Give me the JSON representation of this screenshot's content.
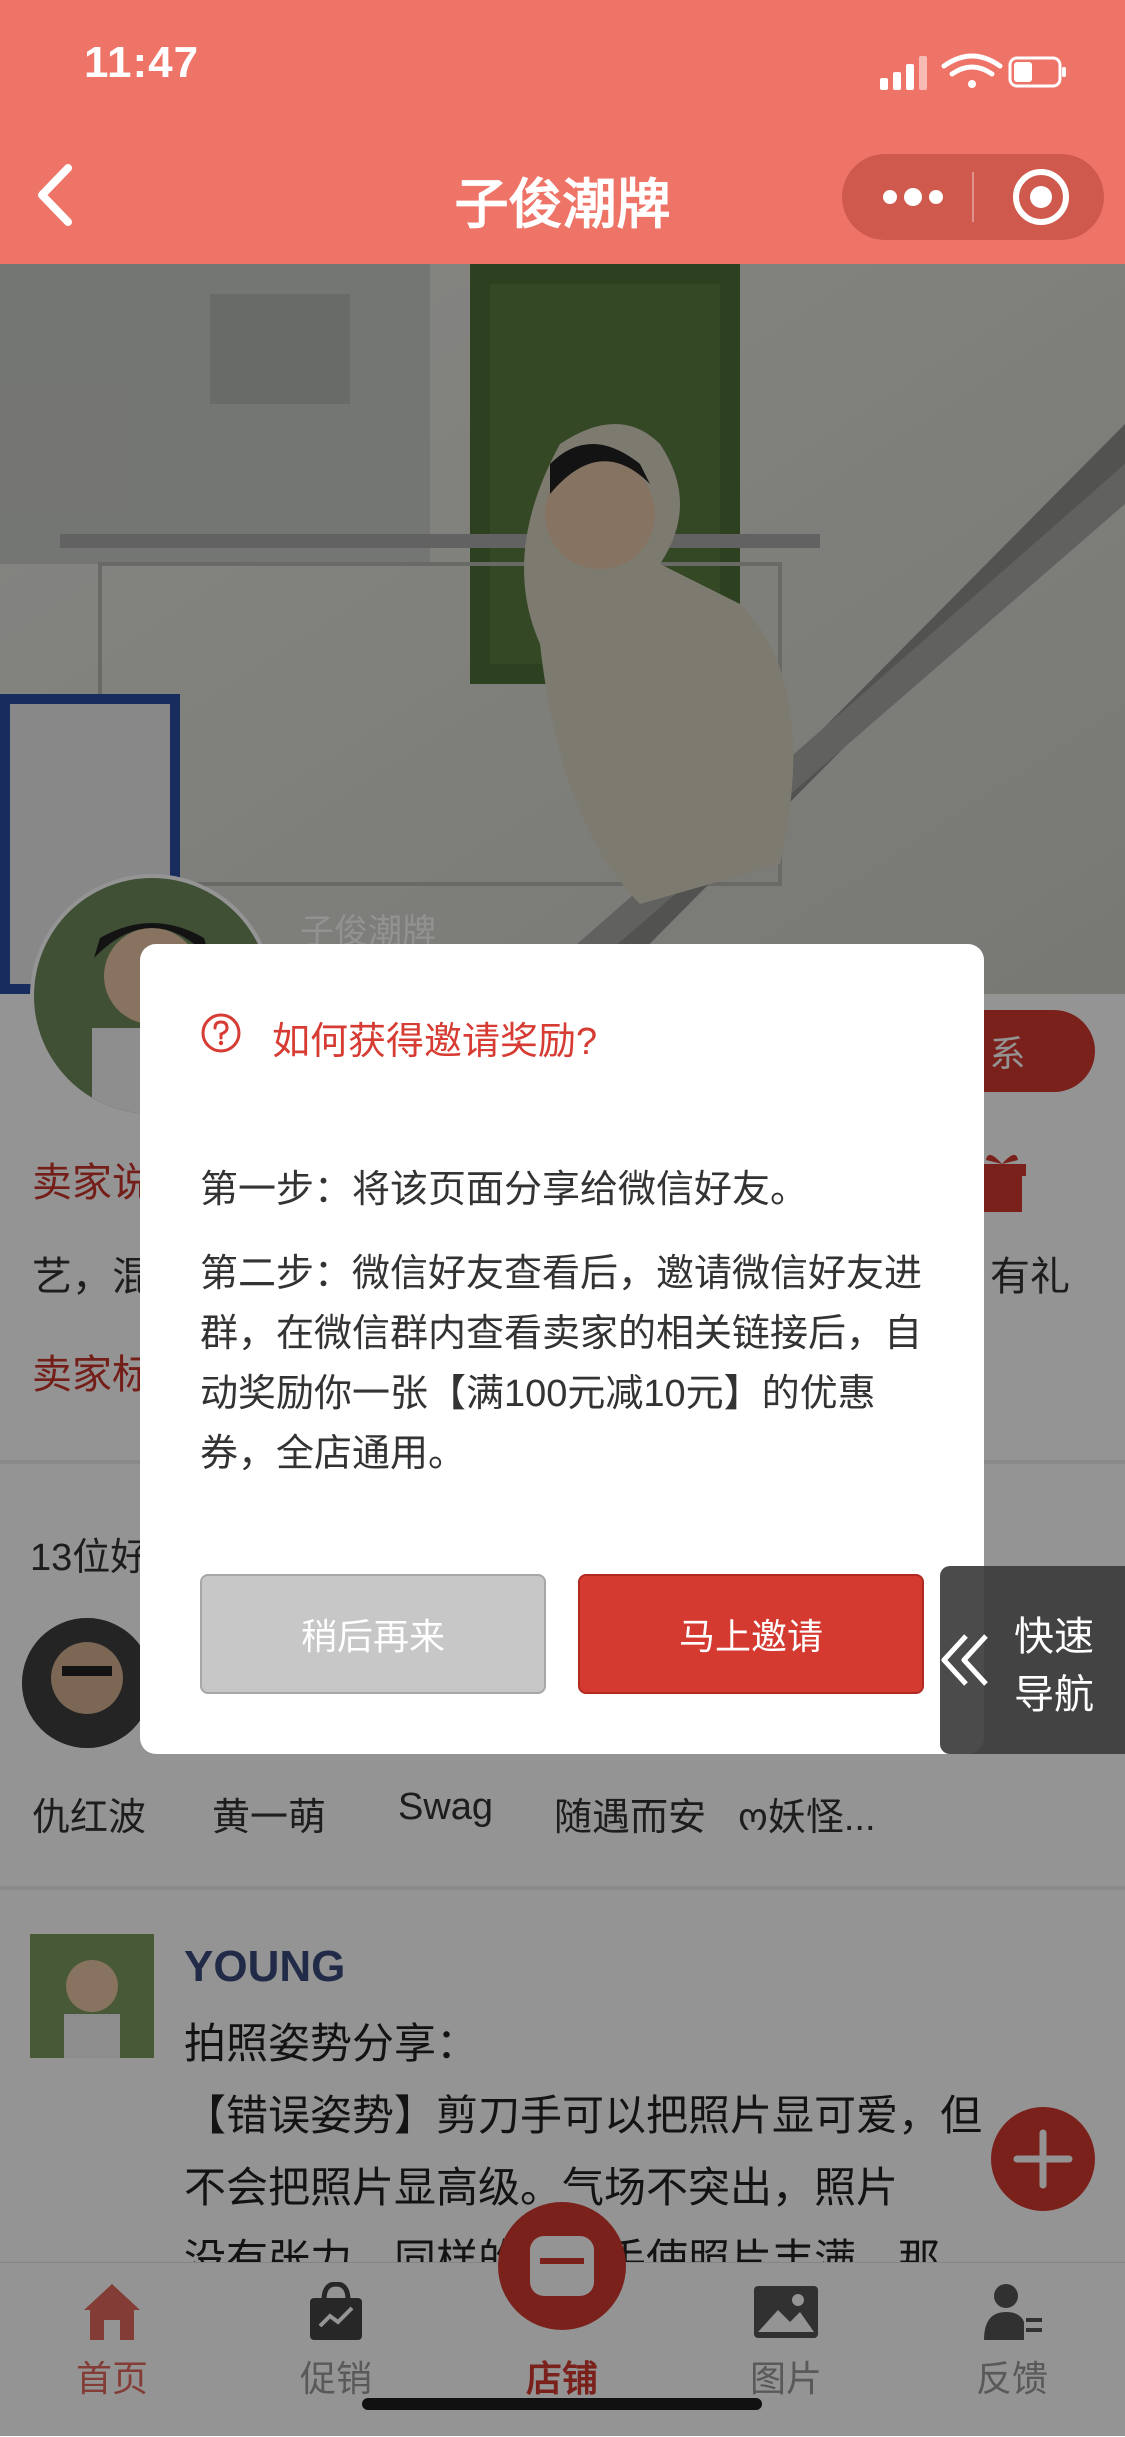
{
  "status_bar": {
    "time": "11:47"
  },
  "nav": {
    "title": "子俊潮牌"
  },
  "hero": {
    "shop_name": "子俊潮牌"
  },
  "seller": {
    "intro_label": "卖家说",
    "intro_text": "艺，混",
    "tag_label": "卖家标",
    "contact_button": "系",
    "gift_text": "有礼"
  },
  "friends": {
    "count_label": "13位好",
    "names": [
      "仇红波",
      "黄一萌",
      "Swag",
      "随遇而安",
      "ო妖怪..."
    ]
  },
  "post": {
    "author": "YOUNG",
    "lines": [
      "拍照姿势分享：",
      "【错误姿势】剪刀手可以把照片显可爱，但",
      "不会把照片显高级。气场不突出，照片",
      "没有张力，同样的运用手使照片丰满，那"
    ]
  },
  "modal": {
    "title": "如何获得邀请奖励?",
    "step1": "第一步：将该页面分享给微信好友。",
    "step2": "第二步：微信好友查看后，邀请微信好友进群，在微信群内查看卖家的相关链接后，自动奖励你一张【满100元减10元】的优惠券，全店通用。",
    "later_button": "稍后再来",
    "invite_button": "马上邀请"
  },
  "quick_nav": {
    "line1": "快速",
    "line2": "导航"
  },
  "tabbar": {
    "items": [
      {
        "label": "首页",
        "active": false
      },
      {
        "label": "促销",
        "active": false
      },
      {
        "label": "店铺",
        "active": true
      },
      {
        "label": "图片",
        "active": false
      },
      {
        "label": "反馈",
        "active": false
      }
    ]
  },
  "colors": {
    "accent": "#ee7468",
    "primary_red": "#d53a31",
    "button_gray": "#c7c7c7"
  }
}
